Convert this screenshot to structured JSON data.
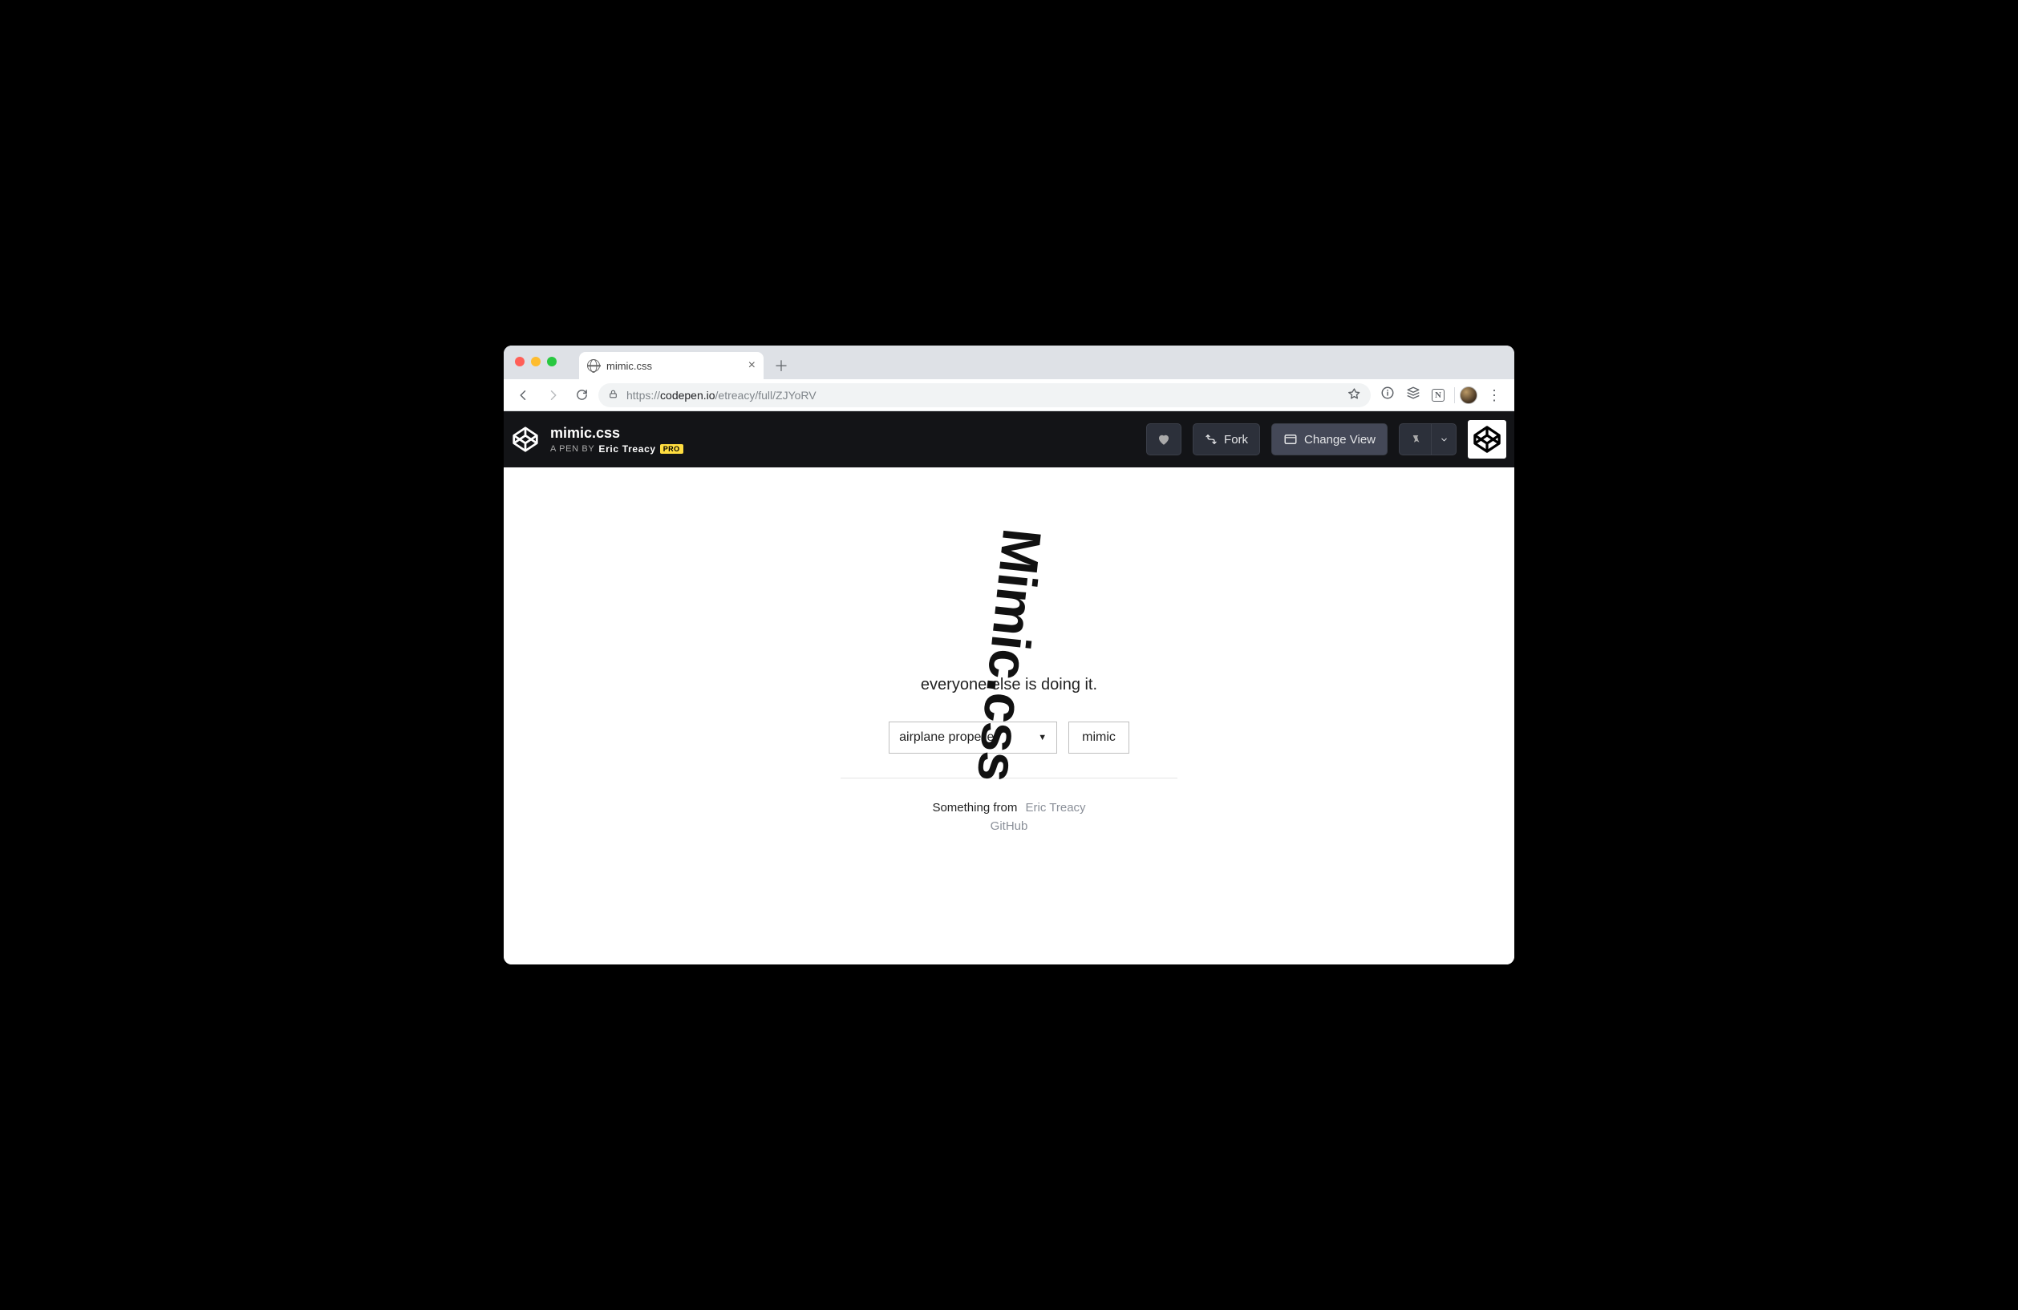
{
  "browser": {
    "tab_title": "mimic.css",
    "url_scheme": "https://",
    "url_host": "codepen.io",
    "url_path": "/etreacy/full/ZJYoRV"
  },
  "codepen": {
    "title": "mimic.css",
    "pen_by_prefix": "A PEN BY",
    "author": "Eric Treacy",
    "pro_label": "PRO",
    "fork_label": "Fork",
    "change_view_label": "Change View"
  },
  "page": {
    "hero_title": "Mimic.css",
    "tagline": "everyone else is doing it.",
    "select_value": "airplane propeller",
    "button_label": "mimic",
    "footer_prefix": "Something from",
    "footer_author": "Eric Treacy",
    "footer_link2": "GitHub"
  }
}
